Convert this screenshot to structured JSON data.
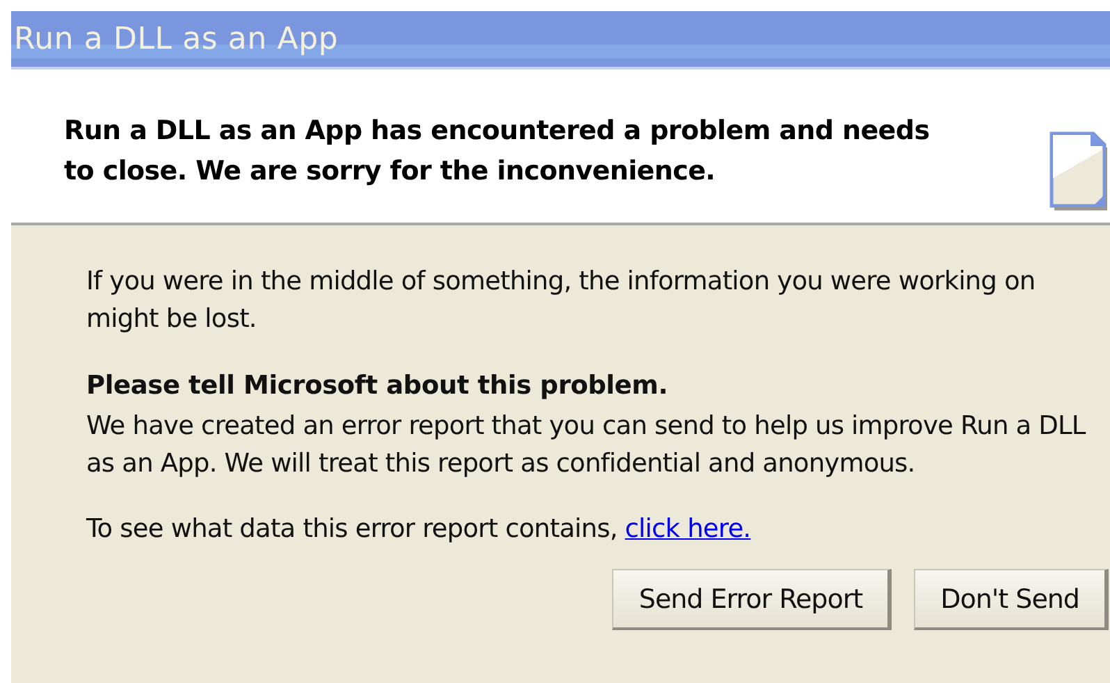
{
  "window": {
    "title": "Run a DLL as an App"
  },
  "header": {
    "message": "Run a DLL as an App has encountered a problem and needs to close.  We are sorry for the inconvenience."
  },
  "body": {
    "warning": "If you were in the middle of something, the information you were working on might be lost.",
    "heading": "Please tell Microsoft about this problem.",
    "report_text": "We have created an error report that you can send to help us improve Run a DLL as an App.  We will treat this report as confidential and anonymous.",
    "details_prompt": "To see what data this error report contains,",
    "details_link": "click here."
  },
  "buttons": [
    {
      "label": "Send Error Report"
    },
    {
      "label": "Don't Send"
    }
  ]
}
